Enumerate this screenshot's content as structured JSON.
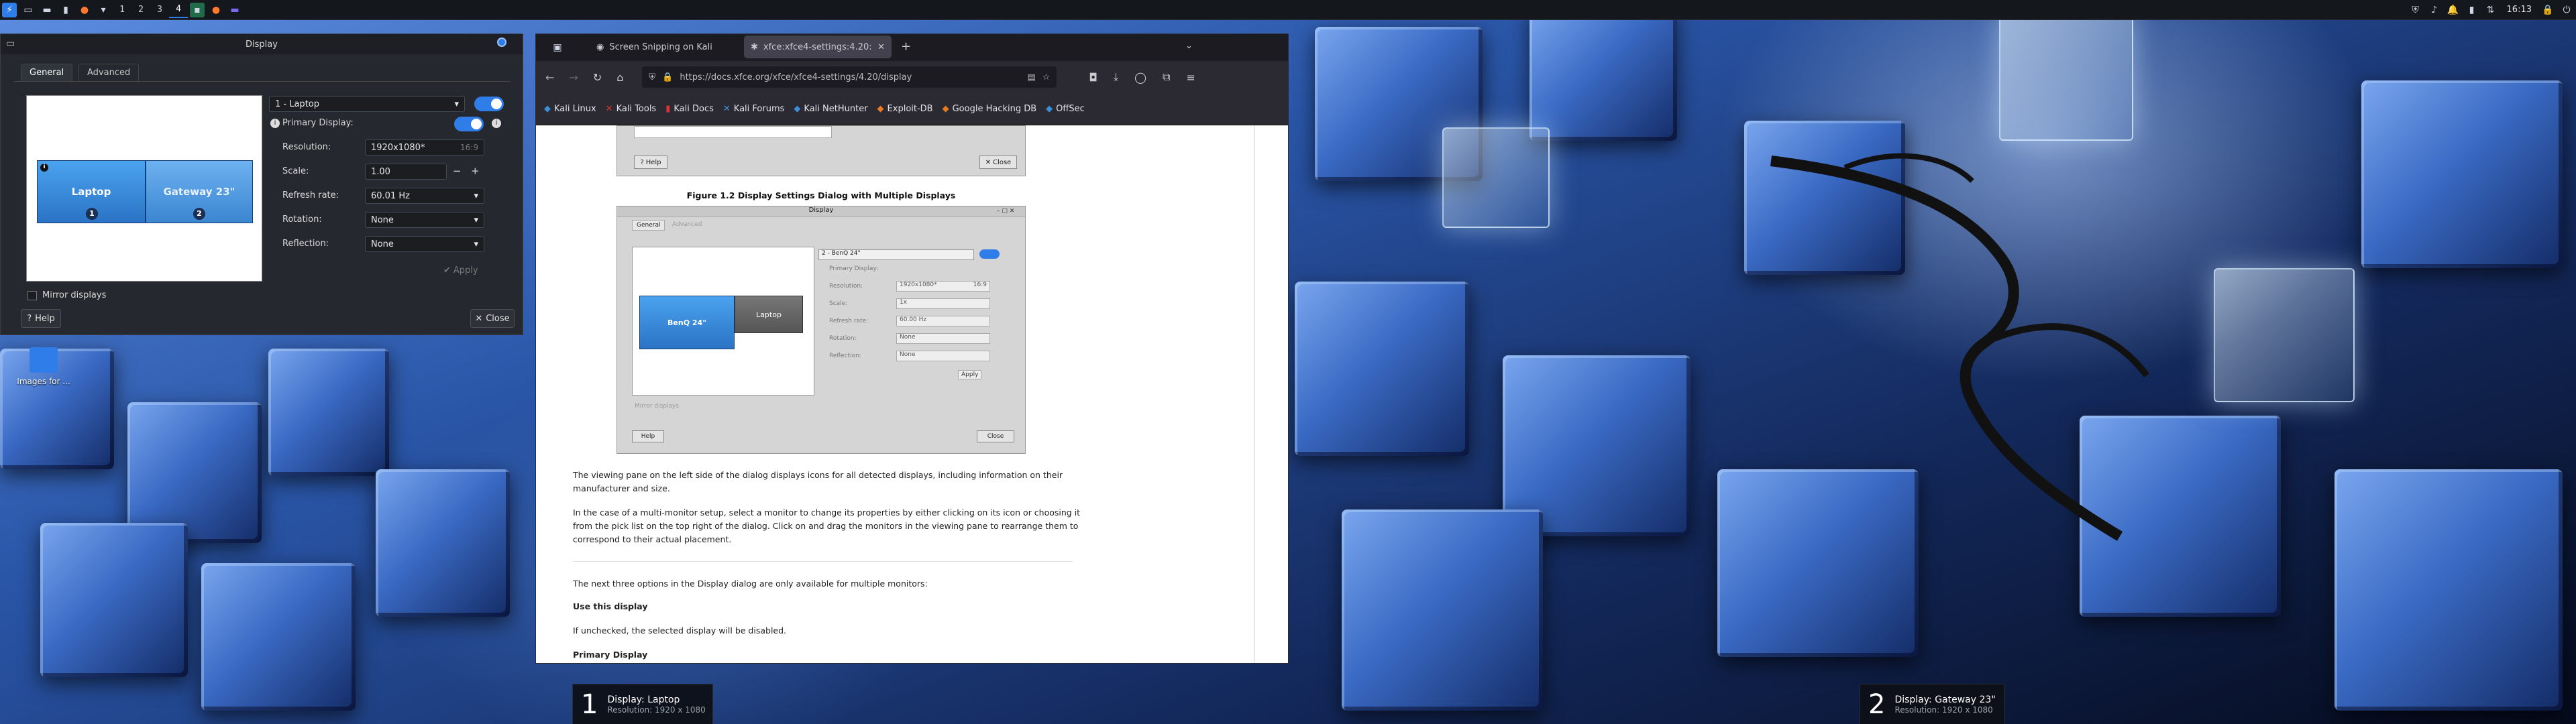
{
  "panel": {
    "workspaces": [
      "1",
      "2",
      "3",
      "4"
    ],
    "active_workspace": "4",
    "clock": "16:13"
  },
  "dialog": {
    "title": "Display",
    "tabs": [
      "General",
      "Advanced"
    ],
    "monitors": [
      {
        "name": "Laptop",
        "num": "1"
      },
      {
        "name": "Gateway 23\"",
        "num": "2"
      }
    ],
    "display_select": "1 - Laptop",
    "primary_display_label": "Primary Display:",
    "resolution_label": "Resolution:",
    "resolution_value": "1920x1080*",
    "resolution_ratio": "16:9",
    "scale_label": "Scale:",
    "scale_value": "1.00",
    "refresh_label": "Refresh rate:",
    "refresh_value": "60.01 Hz",
    "rotation_label": "Rotation:",
    "rotation_value": "None",
    "reflection_label": "Reflection:",
    "reflection_value": "None",
    "apply_label": "Apply",
    "mirror_label": "Mirror displays",
    "help_label": "Help",
    "close_label": "Close",
    "scale_minus": "−",
    "scale_plus": "+"
  },
  "desktop": {
    "icon_label": "Images for ..."
  },
  "browser": {
    "tabs": [
      {
        "label": "Screen Snipping on Kali"
      },
      {
        "label": "xfce:xfce4-settings:4.20:"
      }
    ],
    "url": "https://docs.xfce.org/xfce/xfce4-settings/4.20/display",
    "bookmarks": [
      "Kali Linux",
      "Kali Tools",
      "Kali Docs",
      "Kali Forums",
      "Kali NetHunter",
      "Exploit-DB",
      "Google Hacking DB",
      "OffSec"
    ],
    "page": {
      "help_label": "Help",
      "close_label": "Close",
      "figure_caption": "Figure 1.2 Display Settings Dialog with Multiple Displays",
      "fig": {
        "title": "Display",
        "tabs": [
          "General",
          "Advanced"
        ],
        "monitor1": "BenQ 24\"",
        "monitor2": "Laptop",
        "select": "2 - BenQ 24\"",
        "primary": "Primary Display:",
        "resolution": "Resolution:",
        "resolution_value": "1920x1080*",
        "resolution_ratio": "16:9",
        "scale": "Scale:",
        "scale_value": "1x",
        "refresh": "Refresh rate:",
        "refresh_value": "60.00 Hz",
        "rotation": "Rotation:",
        "rotation_value": "None",
        "reflection": "Reflection:",
        "reflection_value": "None",
        "apply": "Apply",
        "mirror": "Mirror displays",
        "help": "Help",
        "close": "Close"
      },
      "p1": "The viewing pane on the left side of the dialog displays icons for all detected displays, including information on their manufacturer and size.",
      "p2": "In the case of a multi-monitor setup, select a monitor to change its properties by either clicking on its icon or choosing it from the pick list on the top right of the dialog. Click on and drag the monitors in the viewing pane to rearrange them to correspond to their actual placement.",
      "p3": "The next three options in the Display dialog are only available for multiple monitors:",
      "h1": "Use this display",
      "p4": "If unchecked, the selected display will be disabled.",
      "h2": "Primary Display"
    }
  },
  "osd": [
    {
      "num": "1",
      "title": "Display: Laptop",
      "sub": "Resolution: 1920 x 1080"
    },
    {
      "num": "2",
      "title": "Display: Gateway 23\"",
      "sub": "Resolution: 1920 x 1080"
    }
  ],
  "colors": {
    "accent": "#2e7de9",
    "monitor_blue": "#3b8fd9"
  }
}
